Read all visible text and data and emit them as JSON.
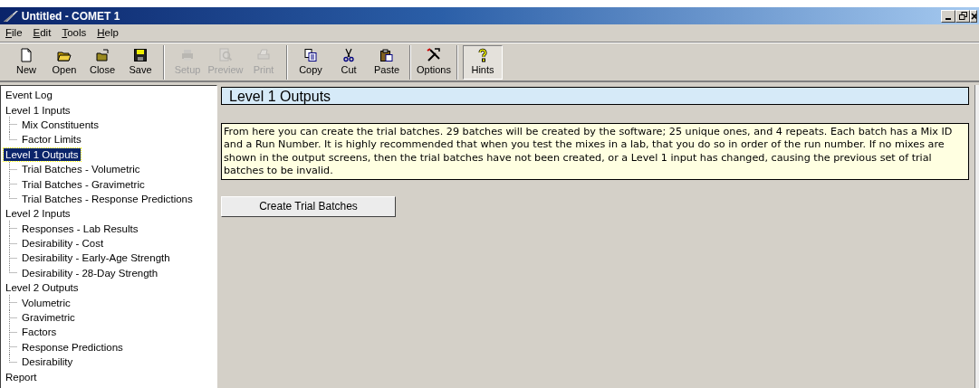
{
  "window": {
    "title": "Untitled - COMET 1"
  },
  "menu": [
    {
      "label": "File"
    },
    {
      "label": "Edit"
    },
    {
      "label": "Tools"
    },
    {
      "label": "Help"
    }
  ],
  "toolbar": [
    {
      "label": "New",
      "disabled": false,
      "pressed": false,
      "separator_after": false
    },
    {
      "label": "Open",
      "disabled": false,
      "pressed": false,
      "separator_after": false
    },
    {
      "label": "Close",
      "disabled": false,
      "pressed": false,
      "separator_after": false
    },
    {
      "label": "Save",
      "disabled": false,
      "pressed": false,
      "separator_after": true
    },
    {
      "label": "Setup",
      "disabled": true,
      "pressed": false,
      "separator_after": false
    },
    {
      "label": "Preview",
      "disabled": true,
      "pressed": false,
      "separator_after": false
    },
    {
      "label": "Print",
      "disabled": true,
      "pressed": false,
      "separator_after": true
    },
    {
      "label": "Copy",
      "disabled": false,
      "pressed": false,
      "separator_after": false
    },
    {
      "label": "Cut",
      "disabled": false,
      "pressed": false,
      "separator_after": false
    },
    {
      "label": "Paste",
      "disabled": false,
      "pressed": false,
      "separator_after": true
    },
    {
      "label": "Options",
      "disabled": false,
      "pressed": false,
      "separator_after": true
    },
    {
      "label": "Hints",
      "disabled": false,
      "pressed": true,
      "separator_after": false
    }
  ],
  "tree": [
    {
      "label": "Event Log",
      "selected": false
    },
    {
      "label": "Level 1 Inputs",
      "selected": false,
      "children": [
        {
          "label": "Mix Constituents",
          "selected": false
        },
        {
          "label": "Factor Limits",
          "selected": false
        }
      ]
    },
    {
      "label": "Level 1 Outputs",
      "selected": true,
      "children": [
        {
          "label": "Trial Batches - Volumetric",
          "selected": false
        },
        {
          "label": "Trial Batches - Gravimetric",
          "selected": false
        },
        {
          "label": "Trial Batches - Response Predictions",
          "selected": false
        }
      ]
    },
    {
      "label": "Level 2 Inputs",
      "selected": false,
      "children": [
        {
          "label": "Responses - Lab Results",
          "selected": false
        },
        {
          "label": "Desirability - Cost",
          "selected": false
        },
        {
          "label": "Desirability - Early-Age Strength",
          "selected": false
        },
        {
          "label": "Desirability - 28-Day Strength",
          "selected": false
        }
      ]
    },
    {
      "label": "Level 2 Outputs",
      "selected": false,
      "children": [
        {
          "label": "Volumetric",
          "selected": false
        },
        {
          "label": "Gravimetric",
          "selected": false
        },
        {
          "label": "Factors",
          "selected": false
        },
        {
          "label": "Response Predictions",
          "selected": false
        },
        {
          "label": "Desirability",
          "selected": false
        }
      ]
    },
    {
      "label": "Report",
      "selected": false
    }
  ],
  "content": {
    "heading": "Level 1 Outputs",
    "hint": "From here you can create the trial batches. 29 batches will be created by the software; 25 unique ones, and 4 repeats. Each batch has a Mix ID and a Run Number. It is highly recommended that when you test the mixes in a lab, that you do so in order of the run number. If no mixes are shown in the output screens, then the trial batches have not been created, or a Level 1 input has changed, causing the previous set of trial batches to be invalid.",
    "button": "Create Trial Batches"
  }
}
